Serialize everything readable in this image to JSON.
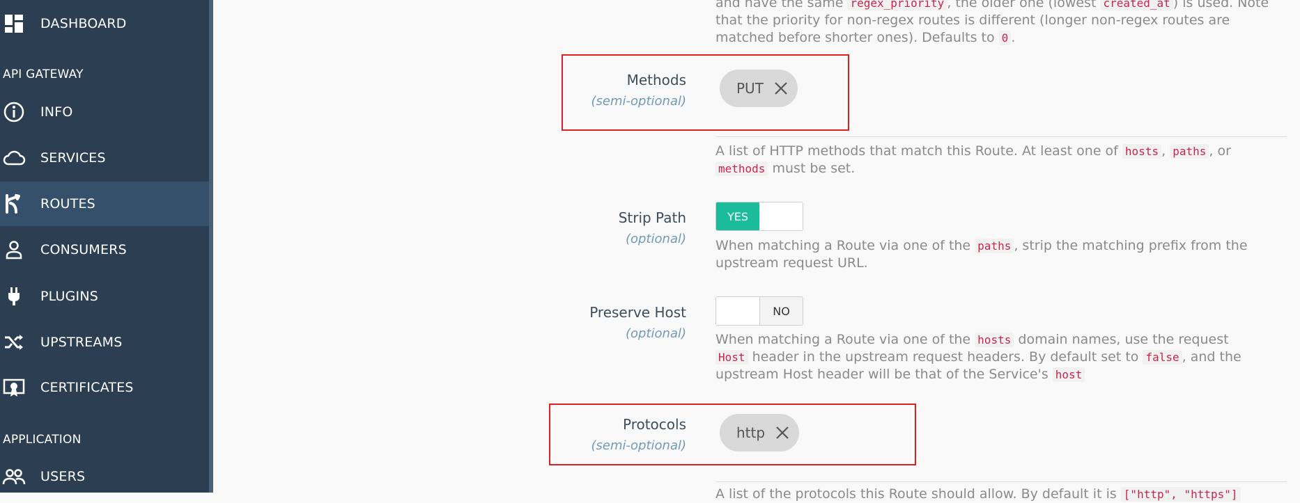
{
  "sidebar": {
    "dashboard": "DASHBOARD",
    "sections": [
      "API GATEWAY",
      "APPLICATION"
    ],
    "items": [
      {
        "label": "INFO",
        "icon": "info-icon"
      },
      {
        "label": "SERVICES",
        "icon": "cloud-icon"
      },
      {
        "label": "ROUTES",
        "icon": "routes-icon"
      },
      {
        "label": "CONSUMERS",
        "icon": "user-icon"
      },
      {
        "label": "PLUGINS",
        "icon": "plug-icon"
      },
      {
        "label": "UPSTREAMS",
        "icon": "shuffle-icon"
      },
      {
        "label": "CERTIFICATES",
        "icon": "certificate-icon"
      }
    ],
    "users": "USERS"
  },
  "top_help": {
    "line1_a": "and have the same",
    "line1_code1": "regex_priority",
    "line1_b": ", the older one (lowest",
    "line1_code2": "created_at",
    "line1_c": ") is used. Note",
    "line2": "that the priority for non-regex routes is different (longer non-regex routes are",
    "line3_a": "matched before shorter ones). Defaults to",
    "line3_code": "0",
    "line3_b": "."
  },
  "methods": {
    "label": "Methods",
    "sub": "(semi-optional)",
    "chip": "PUT",
    "help_a": "A list of HTTP methods that match this Route. At least one of",
    "code1": "hosts",
    "sep1": ",",
    "code2": "paths",
    "sep2": ", or",
    "code3": "methods",
    "help_b": "must be set."
  },
  "strip_path": {
    "label": "Strip Path",
    "sub": "(optional)",
    "toggle": "YES",
    "help_a": "When matching a Route via one of the",
    "code1": "paths",
    "help_b": ", strip the matching prefix from the",
    "help_c": "upstream request URL."
  },
  "preserve_host": {
    "label": "Preserve Host",
    "sub": "(optional)",
    "toggle": "NO",
    "help_a": "When matching a Route via one of the",
    "code1": "hosts",
    "help_b": "domain names, use the request",
    "code2": "Host",
    "help_c": "header in the upstream request headers. By default set to",
    "code3": "false",
    "help_d": ", and the",
    "help_e": "upstream Host header will be that of the Service's",
    "code4": "host"
  },
  "protocols": {
    "label": "Protocols",
    "sub": "(semi-optional)",
    "chip": "http",
    "help_a": "A list of the protocols this Route should allow. By default it is",
    "code1": "[\"http\", \"https\"]"
  }
}
